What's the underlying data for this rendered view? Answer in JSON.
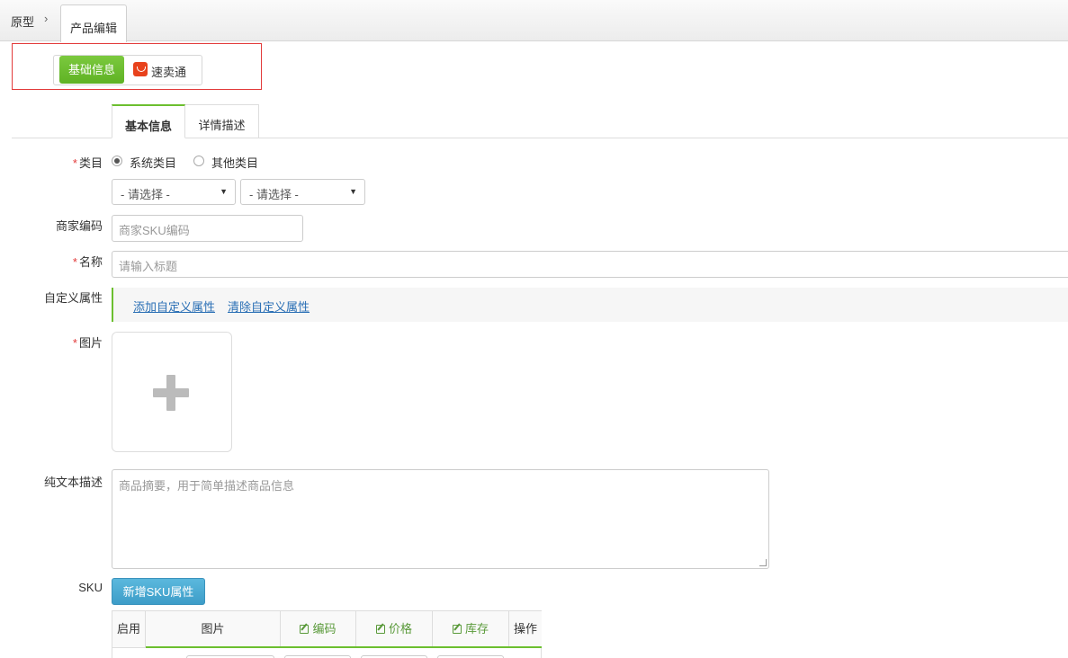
{
  "breadcrumb": {
    "root": "原型",
    "separator": "›",
    "current_tab": "产品编辑"
  },
  "channels": {
    "basic": "基础信息",
    "aliexpress": "速卖通"
  },
  "tabs": [
    {
      "label": "基本信息",
      "active": true
    },
    {
      "label": "详情描述",
      "active": false
    }
  ],
  "form": {
    "category": {
      "label": "类目",
      "options": [
        {
          "label": "系统类目",
          "checked": true
        },
        {
          "label": "其他类目",
          "checked": false
        }
      ],
      "select1": "- 请选择 -",
      "select2": "- 请选择 -"
    },
    "merchant_code": {
      "label": "商家编码",
      "placeholder": "商家SKU编码"
    },
    "name": {
      "label": "名称",
      "placeholder": "请输入标题"
    },
    "custom_attrs": {
      "label": "自定义属性",
      "add": "添加自定义属性",
      "clear": "清除自定义属性"
    },
    "image": {
      "label": "图片"
    },
    "plain_desc": {
      "label": "纯文本描述",
      "placeholder": "商品摘要，用于简单描述商品信息"
    },
    "sku": {
      "label": "SKU",
      "add_button": "新增SKU属性",
      "columns": [
        "启用",
        "图片",
        "编码",
        "价格",
        "库存",
        "操作"
      ]
    }
  },
  "colors": {
    "accent_green": "#6cbf2f",
    "frame_red": "#e23a3a",
    "sku_button_blue": "#3d9dc8",
    "required_red": "#e23a3a"
  }
}
